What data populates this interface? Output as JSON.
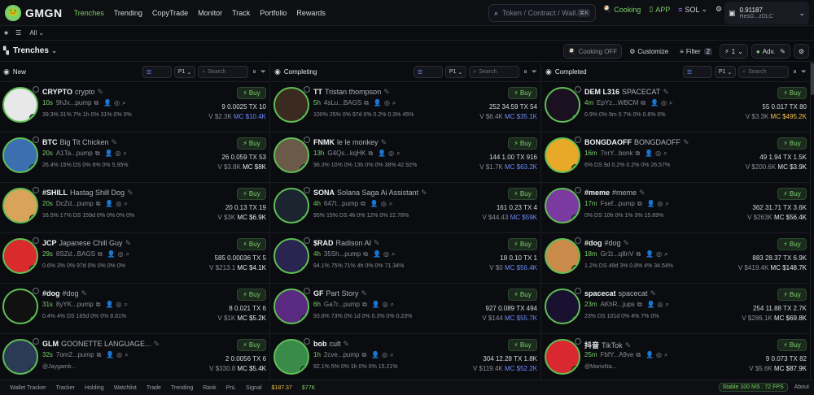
{
  "app": {
    "logo_text": "GMGN"
  },
  "nav": [
    "Trenches",
    "Trending",
    "CopyTrade",
    "Monitor",
    "Track",
    "Portfolio",
    "Rewards"
  ],
  "search": {
    "placeholder": "Token / Contract / Wall...",
    "shortcut": "⌘K"
  },
  "topright": {
    "cooking": "Cooking",
    "cooking_badge": "Free",
    "app": "APP",
    "chain": "SOL",
    "balance": "0.91187",
    "address": "HesG...zDLC"
  },
  "subbar": {
    "all": "All"
  },
  "toolbar": {
    "title": "Trenches",
    "cooking_off": "Cooking OFF",
    "customize": "Customize",
    "filter": "Filter",
    "filter_count": "2",
    "count": "1",
    "adv": "Adv."
  },
  "columns": [
    {
      "title": "New",
      "preset": "P1",
      "search_placeholder": "Search",
      "cards": [
        {
          "ticker": "CRYPTO",
          "name": "crypto",
          "age": "10s",
          "addr": "9hJx...pump",
          "holders": "9",
          "price": "0.0025",
          "tx": "TX 10",
          "metrics": "39.3%  31%  7% 1h  0%  31%  0%  0%",
          "vol": "V $2.3K",
          "mc": "MC $10.4K",
          "mc_color": "bl",
          "bg": "#e8e8e8"
        },
        {
          "ticker": "BTC",
          "name": "Big Tit Chicken",
          "age": "20s",
          "addr": "A1Ta...pump",
          "holders": "26",
          "price": "0.059",
          "tx": "TX 53",
          "metrics": "26.4%  15%  DS  0%  6%  0%  5.95%",
          "vol": "V $3.8K",
          "mc": "MC $8K",
          "mc_color": "",
          "bg": "#3b6fb0"
        },
        {
          "ticker": "#SHILL",
          "name": "Hastag Shill Dog",
          "age": "20s",
          "addr": "DcZd...pump",
          "holders": "20",
          "price": "0.13",
          "tx": "TX 19",
          "metrics": "16.5%  17%  DS 159d  0%  0%  0%  0%",
          "vol": "V $3K",
          "mc": "MC $6.9K",
          "mc_color": "",
          "bg": "#d9a45a"
        },
        {
          "ticker": "JCP",
          "name": "Japanese Chill Guy",
          "age": "29s",
          "addr": "8SZd...BAGS",
          "holders": "585",
          "price": "0.00036",
          "tx": "TX 5",
          "metrics": "0.6%  3%  0% 97d  0%  0%  0%  0%",
          "vol": "V $213.1",
          "mc": "MC $4.1K",
          "mc_color": "",
          "bg": "#d92b2b"
        },
        {
          "ticker": "#dog",
          "name": "#dog",
          "age": "31s",
          "addr": "8yYK...pump",
          "holders": "8",
          "price": "0.021",
          "tx": "TX 6",
          "metrics": "0.4%  4%  DS 165d  0%  0%  8.81%",
          "vol": "V $1K",
          "mc": "MC $5.2K",
          "mc_color": "",
          "bg": "#111"
        },
        {
          "ticker": "GLM",
          "name": "GOONETTE LANGUAGE...",
          "age": "32s",
          "addr": "7om2...pump",
          "holders": "2",
          "price": "0.0056",
          "tx": "TX 6",
          "metrics": "@Jaygamb...",
          "vol": "V $330.8",
          "mc": "MC $5.4K",
          "mc_color": "",
          "bg": "#2b3a55"
        }
      ]
    },
    {
      "title": "Completing",
      "preset": "P1",
      "search_placeholder": "Search",
      "cards": [
        {
          "ticker": "TT",
          "name": "Tristan thompson",
          "age": "5h",
          "addr": "4sLu...BAGS",
          "holders": "252",
          "price": "34.59",
          "tx": "TX 54",
          "metrics": "100%  25%  0% 97d  0%  0.2%  0.3%  45%",
          "vol": "V $6.4K",
          "mc": "MC $35.1K",
          "mc_color": "bl",
          "bg": "#3a2a20"
        },
        {
          "ticker": "FNMK",
          "name": "le le monkey",
          "age": "13h",
          "addr": "G4Qs...kqHK",
          "holders": "144",
          "price": "1.00",
          "tx": "TX 916",
          "metrics": "96.3%  10%  0% 13h  0%  0%  38%  42.92%",
          "vol": "V $1.7K",
          "mc": "MC $63.2K",
          "mc_color": "bl",
          "bg": "#6b5a48"
        },
        {
          "ticker": "SONA",
          "name": "Solana Saga Ai Assistant",
          "age": "4h",
          "addr": "647t...pump",
          "holders": "161",
          "price": "0.23",
          "tx": "TX 4",
          "metrics": "95%  15%  DS 4h  0%  12%  0%  22.78%",
          "vol": "V $44.43",
          "mc": "MC $59K",
          "mc_color": "bl",
          "bg": "#1c2430"
        },
        {
          "ticker": "$RAD",
          "name": "Radison AI",
          "age": "4h",
          "addr": "35Sh...pump",
          "holders": "18",
          "price": "0.10",
          "tx": "TX 1",
          "metrics": "94.1%  75%  71% 4h  0%  0%  71.34%",
          "vol": "V $0",
          "mc": "MC $56.4K",
          "mc_color": "bl",
          "bg": "#2a2550"
        },
        {
          "ticker": "GF",
          "name": "Part Story",
          "age": "6h",
          "addr": "Ga7r...pump",
          "holders": "927",
          "price": "0.089",
          "tx": "TX 494",
          "metrics": "93.8%  73%  0% 1d  0%  0.3%  0%  0.23%",
          "vol": "V $144",
          "mc": "MC $55.7K",
          "mc_color": "bl",
          "bg": "#5a2a80"
        },
        {
          "ticker": "bob",
          "name": "cult",
          "age": "1h",
          "addr": "2cve...pump",
          "holders": "304",
          "price": "12.28",
          "tx": "TX 1.8K",
          "metrics": "92.1%  5%  0% 1h  0%  0%  15.21%",
          "vol": "V $119.4K",
          "mc": "MC $52.2K",
          "mc_color": "bl",
          "bg": "#3a8a4a"
        }
      ]
    },
    {
      "title": "Completed",
      "preset": "P1",
      "search_placeholder": "Search",
      "cards": [
        {
          "ticker": "DEM L316",
          "name": "SPACECAT",
          "age": "4m",
          "addr": "EpYz...WBCM",
          "holders": "55",
          "price": "0.017",
          "tx": "TX 80",
          "metrics": "0.9%  0% 9m  0.7%  0%  0.8%  0%",
          "vol": "V $3.3K",
          "mc": "MC $495.2K",
          "mc_color": "yl",
          "bg": "#1a1020"
        },
        {
          "ticker": "BONGDAOFF",
          "name": "BONGDAOFF",
          "age": "16m",
          "addr": "7nrY...bonk",
          "holders": "49",
          "price": "1.94",
          "tx": "TX 1.5K",
          "metrics": "6%  DS 9d  0.2%  0.2%  0%  26.57%",
          "vol": "V $200.6K",
          "mc": "MC $3.9K",
          "mc_color": "",
          "bg": "#e8a928"
        },
        {
          "ticker": "#meme",
          "name": "#meme",
          "age": "17m",
          "addr": "Fsef...pump",
          "holders": "362",
          "price": "31.71",
          "tx": "TX 3.6K",
          "metrics": "0%  DS 10h  0%  1%  3%  15.69%",
          "vol": "V $263K",
          "mc": "MC $56.4K",
          "mc_color": "",
          "bg": "#7a3aa0"
        },
        {
          "ticker": "#dog",
          "name": "#dog",
          "age": "18m",
          "addr": "Gr1t...q8nV",
          "holders": "883",
          "price": "28.37",
          "tx": "TX 6.9K",
          "metrics": "1.2%  DS 49d  3%  0.8%  4%  34.54%",
          "vol": "V $419.4K",
          "mc": "MC $148.7K",
          "mc_color": "",
          "bg": "#c98a4a"
        },
        {
          "ticker": "spacecat",
          "name": "spacecat",
          "age": "23m",
          "addr": "AKhR...jups",
          "holders": "254",
          "price": "11.88",
          "tx": "TX 2.7K",
          "metrics": "23%  DS 101d  0%  4%  7%  0%",
          "vol": "V $286.1K",
          "mc": "MC $69.8K",
          "mc_color": "",
          "bg": "#1a1030"
        },
        {
          "ticker": "抖音",
          "name": "TikTok",
          "age": "25m",
          "addr": "FbfY...A9ve",
          "holders": "9",
          "price": "0.073",
          "tx": "TX 82",
          "metrics": "@MarioNa...",
          "vol": "V $5.6K",
          "mc": "MC $87.9K",
          "mc_color": "",
          "bg": "#d9282f"
        }
      ]
    }
  ],
  "bottombar": [
    "Wallet Tracker",
    "Tracker",
    "Holding",
    "Watchlist",
    "Trade",
    "Trending",
    "Rank",
    "PnL",
    "Signal",
    "$187.37",
    "$77K"
  ],
  "bottom_right": {
    "stable": "Stable 100 MS : 72 FPS",
    "about": "About"
  }
}
